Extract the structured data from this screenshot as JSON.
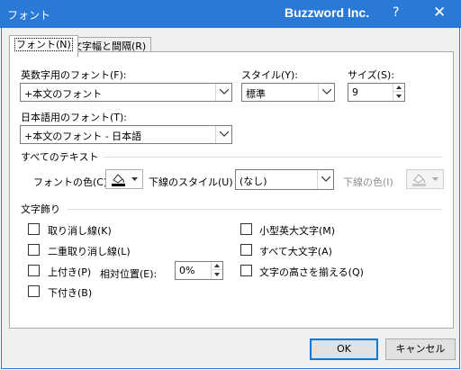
{
  "window": {
    "title": "フォント",
    "brand": "Buzzword Inc.",
    "help": "?",
    "close": "✕"
  },
  "tabs": [
    {
      "label": "フォント(N)",
      "active": true
    },
    {
      "label": "文字幅と間隔(R)",
      "active": false
    }
  ],
  "latin_font": {
    "label": "英数字用のフォント(F):",
    "value": "+本文のフォント"
  },
  "style": {
    "label": "スタイル(Y):",
    "value": "標準"
  },
  "size": {
    "label": "サイズ(S):",
    "value": "9"
  },
  "japanese_font": {
    "label": "日本語用のフォント(T):",
    "value": "+本文のフォント - 日本語"
  },
  "all_text": {
    "heading": "すべてのテキスト",
    "font_color_label": "フォントの色(C)",
    "underline_style_label": "下線のスタイル(U)",
    "underline_style_value": "(なし)",
    "underline_color_label": "下線の色(I)"
  },
  "effects": {
    "heading": "文字飾り",
    "strikethrough": "取り消し線(K)",
    "double_strikethrough": "二重取り消し線(L)",
    "superscript": "上付き(P)",
    "offset_label": "相対位置(E):",
    "offset_value": "0%",
    "subscript": "下付き(B)",
    "small_caps": "小型英大文字(M)",
    "all_caps": "すべて大文字(A)",
    "equalize_height": "文字の高さを揃える(Q)"
  },
  "buttons": {
    "ok": "OK",
    "cancel": "キャンセル"
  }
}
